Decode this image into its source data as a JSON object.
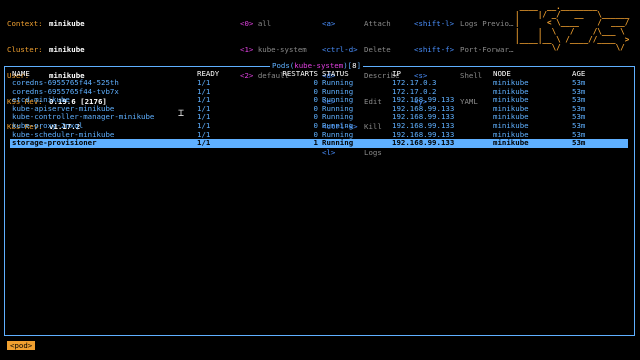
{
  "info": [
    {
      "label": "Context:",
      "value": "minikube"
    },
    {
      "label": "Cluster:",
      "value": "minikube"
    },
    {
      "label": "User:",
      "value": "minikube"
    },
    {
      "label": "K9s Rev:",
      "value": "0.19.6 [2176]"
    },
    {
      "label": "K8s Rev:",
      "value": "v1.17.2"
    }
  ],
  "namespaces": [
    {
      "key": "<0>",
      "label": "all"
    },
    {
      "key": "<1>",
      "label": "kube-system"
    },
    {
      "key": "<2>",
      "label": "default"
    }
  ],
  "hotkeys_col1": [
    {
      "key": "<a>",
      "label": "Attach"
    },
    {
      "key": "<ctrl-d>",
      "label": "Delete"
    },
    {
      "key": "<d>",
      "label": "Describe"
    },
    {
      "key": "<e>",
      "label": "Edit"
    },
    {
      "key": "<ctrl-k>",
      "label": "Kill"
    },
    {
      "key": "<l>",
      "label": "Logs"
    }
  ],
  "hotkeys_col2": [
    {
      "key": "<shift-l>",
      "label": "Logs Previo…"
    },
    {
      "key": "<shift-f>",
      "label": "Port-Forwar…"
    },
    {
      "key": "<s>",
      "label": "Shell"
    },
    {
      "key": "<y>",
      "label": "YAML"
    }
  ],
  "logo_lines": [
    " ____  __.________       ",
    "|    |/ _/   __   \\______",
    "|      < \\____    /  ___/",
    "|    |  \\   /    /\\___ \\ ",
    "|____|__ \\ /____//____  >",
    "        \\/            \\/ "
  ],
  "table": {
    "title_prefix": "Pods(",
    "namespace": "kube-system",
    "title_mid": ")[",
    "count": "8",
    "title_suffix": "]",
    "headers": {
      "name": "NAME",
      "ready": "READY",
      "restarts": "RESTARTS",
      "status": "STATUS",
      "ip": "IP",
      "node": "NODE",
      "age": "AGE"
    },
    "rows": [
      {
        "name": "coredns-6955765f44-525th",
        "ready": "1/1",
        "restarts": "0",
        "status": "Running",
        "ip": "172.17.0.3",
        "node": "minikube",
        "age": "53m"
      },
      {
        "name": "coredns-6955765f44-tvb7x",
        "ready": "1/1",
        "restarts": "0",
        "status": "Running",
        "ip": "172.17.0.2",
        "node": "minikube",
        "age": "53m"
      },
      {
        "name": "etcd-minikube",
        "ready": "1/1",
        "restarts": "0",
        "status": "Running",
        "ip": "192.168.99.133",
        "node": "minikube",
        "age": "53m"
      },
      {
        "name": "kube-apiserver-minikube",
        "ready": "1/1",
        "restarts": "0",
        "status": "Running",
        "ip": "192.168.99.133",
        "node": "minikube",
        "age": "53m"
      },
      {
        "name": "kube-controller-manager-minikube",
        "ready": "1/1",
        "restarts": "0",
        "status": "Running",
        "ip": "192.168.99.133",
        "node": "minikube",
        "age": "53m"
      },
      {
        "name": "kube-proxy-2nxql",
        "ready": "1/1",
        "restarts": "0",
        "status": "Running",
        "ip": "192.168.99.133",
        "node": "minikube",
        "age": "53m"
      },
      {
        "name": "kube-scheduler-minikube",
        "ready": "1/1",
        "restarts": "0",
        "status": "Running",
        "ip": "192.168.99.133",
        "node": "minikube",
        "age": "53m"
      },
      {
        "name": "storage-provisioner",
        "ready": "1/1",
        "restarts": "1",
        "status": "Running",
        "ip": "192.168.99.133",
        "node": "minikube",
        "age": "53m"
      }
    ],
    "selected_index": 7
  },
  "breadcrumb": "<pod>",
  "colors": {
    "accent": "#f0a030",
    "table": "#5fb0ff",
    "namespace": "#e040e0"
  }
}
